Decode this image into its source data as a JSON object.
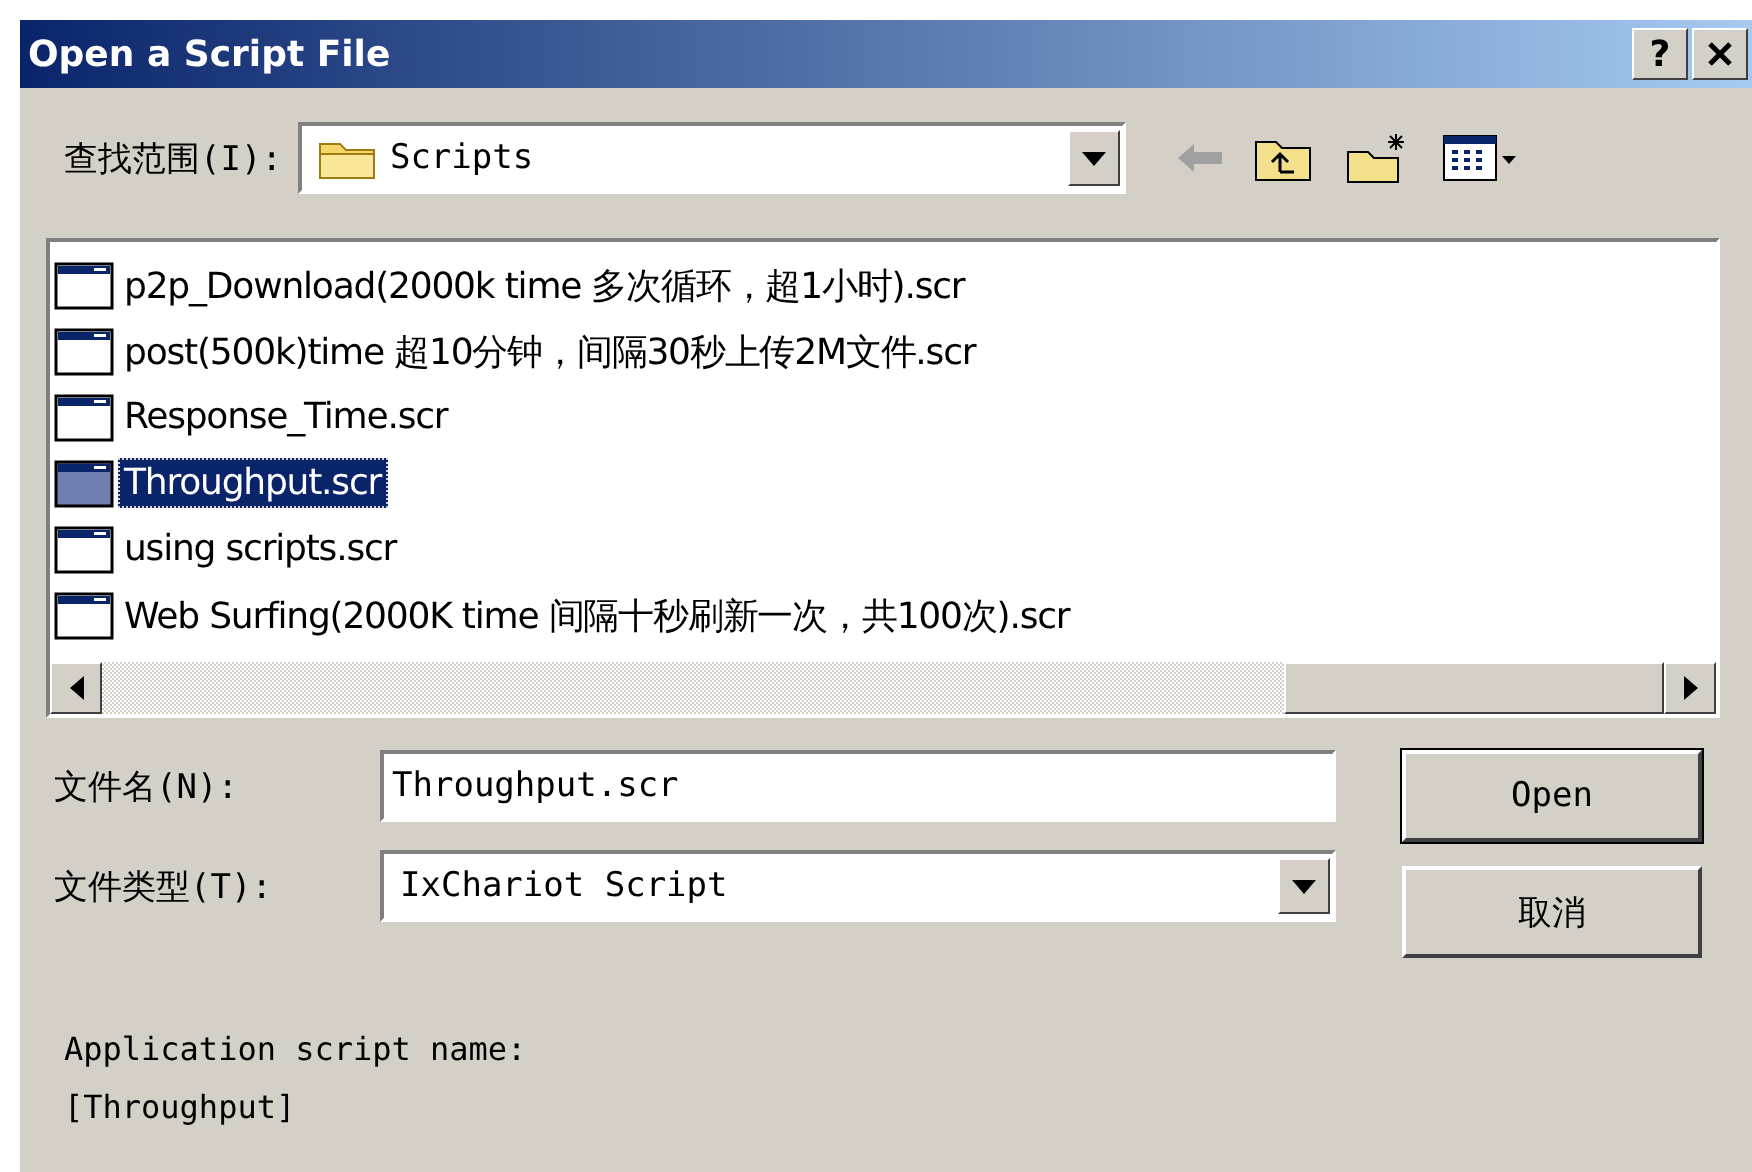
{
  "window": {
    "title": "Open a Script File",
    "help_button": "?"
  },
  "look_in": {
    "label": "查找范围(I):",
    "value": "Scripts"
  },
  "files": [
    {
      "name": "p2p_Download(2000k time 多次循环，超1小时).scr",
      "selected": false
    },
    {
      "name": "post(500k)time 超10分钟，间隔30秒上传2M文件.scr",
      "selected": false
    },
    {
      "name": "Response_Time.scr",
      "selected": false
    },
    {
      "name": "Throughput.scr",
      "selected": true
    },
    {
      "name": "using scripts.scr",
      "selected": false
    },
    {
      "name": "Web Surfing(2000K time 间隔十秒刷新一次，共100次).scr",
      "selected": false
    }
  ],
  "file_name": {
    "label": "文件名(N):",
    "value": "Throughput.scr"
  },
  "file_type": {
    "label": "文件类型(T):",
    "value": "IxChariot Script"
  },
  "buttons": [
    {
      "label": "Open",
      "kind": "default"
    },
    {
      "label": "取消",
      "kind": "normal"
    }
  ],
  "description": [
    "Application script name:",
    "[Throughput]"
  ]
}
